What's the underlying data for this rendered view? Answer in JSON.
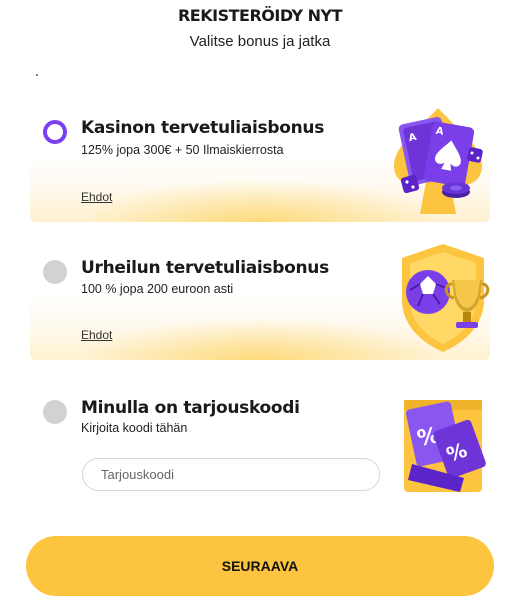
{
  "header": {
    "title": "REKISTERÖIDY NYT",
    "subtitle": "Valitse bonus ja jatka"
  },
  "bonuses": [
    {
      "title": "Kasinon tervetuliaisbonus",
      "description": "125% jopa 300€ + 50 Ilmaiskierrosta",
      "terms_label": "Ehdot",
      "selected": true,
      "image_icon": "casino-cards-icon"
    },
    {
      "title": "Urheilun tervetuliaisbonus",
      "description": "100 % jopa 200 euroon asti",
      "terms_label": "Ehdot",
      "selected": false,
      "image_icon": "sports-trophy-icon"
    },
    {
      "title": "Minulla on tarjouskoodi",
      "description": "Kirjoita koodi tähän",
      "selected": false,
      "image_icon": "promo-ticket-icon"
    }
  ],
  "promo_input": {
    "placeholder": "Tarjouskoodi",
    "value": ""
  },
  "next_button": {
    "label": "SEURAAVA"
  },
  "colors": {
    "accent_purple": "#7b3ff2",
    "button_yellow": "#fdc43f",
    "radio_off": "#d2d2d2"
  }
}
